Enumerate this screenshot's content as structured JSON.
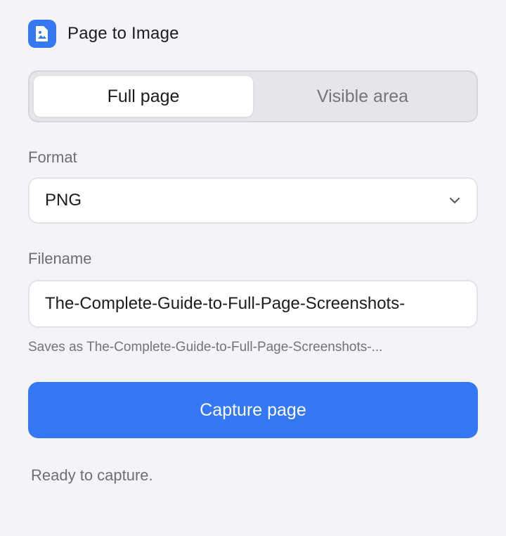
{
  "header": {
    "title": "Page to Image",
    "icon": "image-file-icon",
    "accent_color": "#3478f6"
  },
  "capture_mode": {
    "options": [
      {
        "label": "Full page",
        "selected": true
      },
      {
        "label": "Visible area",
        "selected": false
      }
    ]
  },
  "format": {
    "label": "Format",
    "selected": "PNG",
    "icon": "chevron-down-icon"
  },
  "filename": {
    "label": "Filename",
    "value": "The-Complete-Guide-to-Full-Page-Screenshots-",
    "hint": "Saves as The-Complete-Guide-to-Full-Page-Screenshots-..."
  },
  "capture_button": {
    "label": "Capture page",
    "color": "#3478f6"
  },
  "status": {
    "text": "Ready to capture."
  }
}
